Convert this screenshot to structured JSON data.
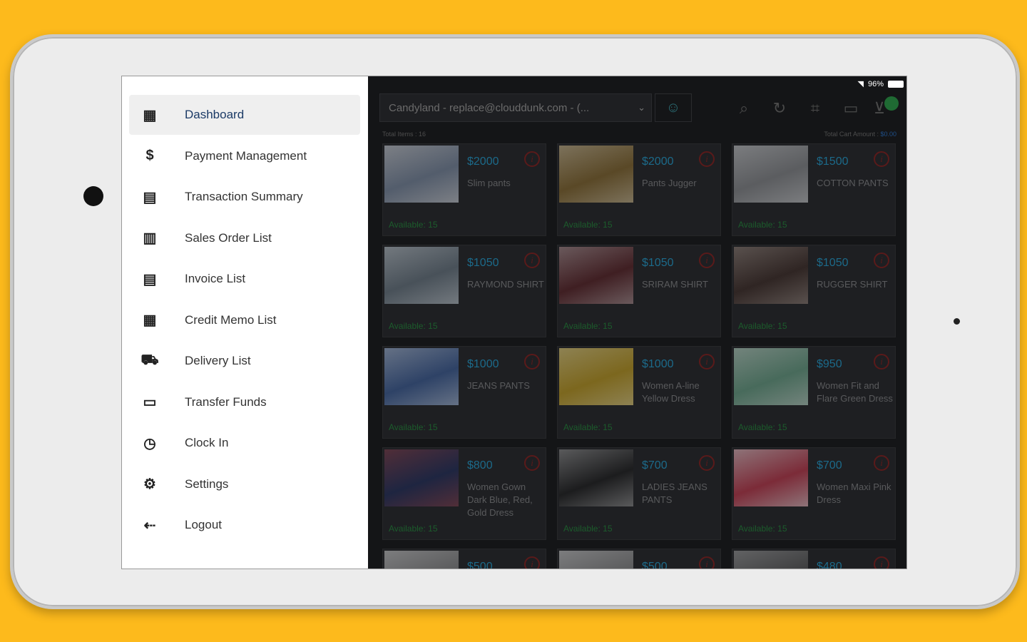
{
  "drawer": {
    "items": [
      {
        "label": "Dashboard",
        "icon": "dashboard-icon",
        "glyph": "▦"
      },
      {
        "label": "Payment Management",
        "icon": "dollar-icon",
        "glyph": "$"
      },
      {
        "label": "Transaction Summary",
        "icon": "document-icon",
        "glyph": "▤"
      },
      {
        "label": "Sales Order List",
        "icon": "clipboard-icon",
        "glyph": "▥"
      },
      {
        "label": "Invoice List",
        "icon": "invoice-icon",
        "glyph": "▤"
      },
      {
        "label": "Credit Memo List",
        "icon": "memo-icon",
        "glyph": "▦"
      },
      {
        "label": "Delivery List",
        "icon": "truck-icon",
        "glyph": "⛟"
      },
      {
        "label": "Transfer Funds",
        "icon": "cash-icon",
        "glyph": "▭"
      },
      {
        "label": "Clock In",
        "icon": "clock-icon",
        "glyph": "◷"
      },
      {
        "label": "Settings",
        "icon": "gear-icon",
        "glyph": "⚙"
      },
      {
        "label": "Logout",
        "icon": "logout-icon",
        "glyph": "⇠"
      }
    ]
  },
  "status": {
    "battery": "96%"
  },
  "header": {
    "customer_select": "Candyland - replace@clouddunk.com - (...",
    "total_items_label": "Total Items : 16",
    "total_cart_label": "Total Cart Amount : ",
    "total_cart_value": "$0.00"
  },
  "products": [
    {
      "price": "$2000",
      "name": "Slim pants",
      "avail": "Available: 15",
      "c1": "#7e8fa8",
      "c2": "#c9ced6"
    },
    {
      "price": "$2000",
      "name": "Pants Jugger",
      "avail": "Available: 15",
      "c1": "#8a6a2a",
      "c2": "#c9b58a"
    },
    {
      "price": "$1500",
      "name": "COTTON PANTS",
      "avail": "Available: 15",
      "c1": "#8d8f92",
      "c2": "#c7c9cb"
    },
    {
      "price": "$1050",
      "name": "RAYMOND SHIRT",
      "avail": "Available: 15",
      "c1": "#6b7a86",
      "c2": "#b8c2ca"
    },
    {
      "price": "$1050",
      "name": "SRIRAM SHIRT",
      "avail": "Available: 15",
      "c1": "#5a1e22",
      "c2": "#a8898b"
    },
    {
      "price": "$1050",
      "name": "RUGGER SHIRT",
      "avail": "Available: 15",
      "c1": "#3d2a24",
      "c2": "#8a7a72"
    },
    {
      "price": "$1000",
      "name": "JEANS PANTS",
      "avail": "Available: 15",
      "c1": "#3b5f9e",
      "c2": "#9fb4d6"
    },
    {
      "price": "$1000",
      "name": "Women A-line Yellow Dress",
      "avail": "Available: 15",
      "c1": "#c9a21b",
      "c2": "#e8d27a"
    },
    {
      "price": "$950",
      "name": "Women Fit and Flare Green Dress",
      "avail": "Available: 15",
      "c1": "#6aa88a",
      "c2": "#b8d6c6"
    },
    {
      "price": "$800",
      "name": "Women Gown Dark Blue, Red, Gold Dress",
      "avail": "Available: 15",
      "c1": "#1e2a5a",
      "c2": "#7a3a4a"
    },
    {
      "price": "$700",
      "name": "LADIES JEANS PANTS",
      "avail": "Available: 15",
      "c1": "#1a1a1a",
      "c2": "#8a8a8a"
    },
    {
      "price": "$700",
      "name": "Women Maxi Pink Dress",
      "avail": "Available: 15",
      "c1": "#c8354a",
      "c2": "#e9b8bf"
    },
    {
      "price": "$500",
      "name": "",
      "avail": "",
      "c1": "#8a8a8a",
      "c2": "#c9c9c9"
    },
    {
      "price": "$500",
      "name": "",
      "avail": "",
      "c1": "#8a8a8a",
      "c2": "#c9c9c9"
    },
    {
      "price": "$480",
      "name": "",
      "avail": "",
      "c1": "#555",
      "c2": "#999"
    }
  ],
  "colors": {
    "accent": "#1c6a8a",
    "available": "#1c5c2c",
    "background": "#FDBA1C"
  }
}
